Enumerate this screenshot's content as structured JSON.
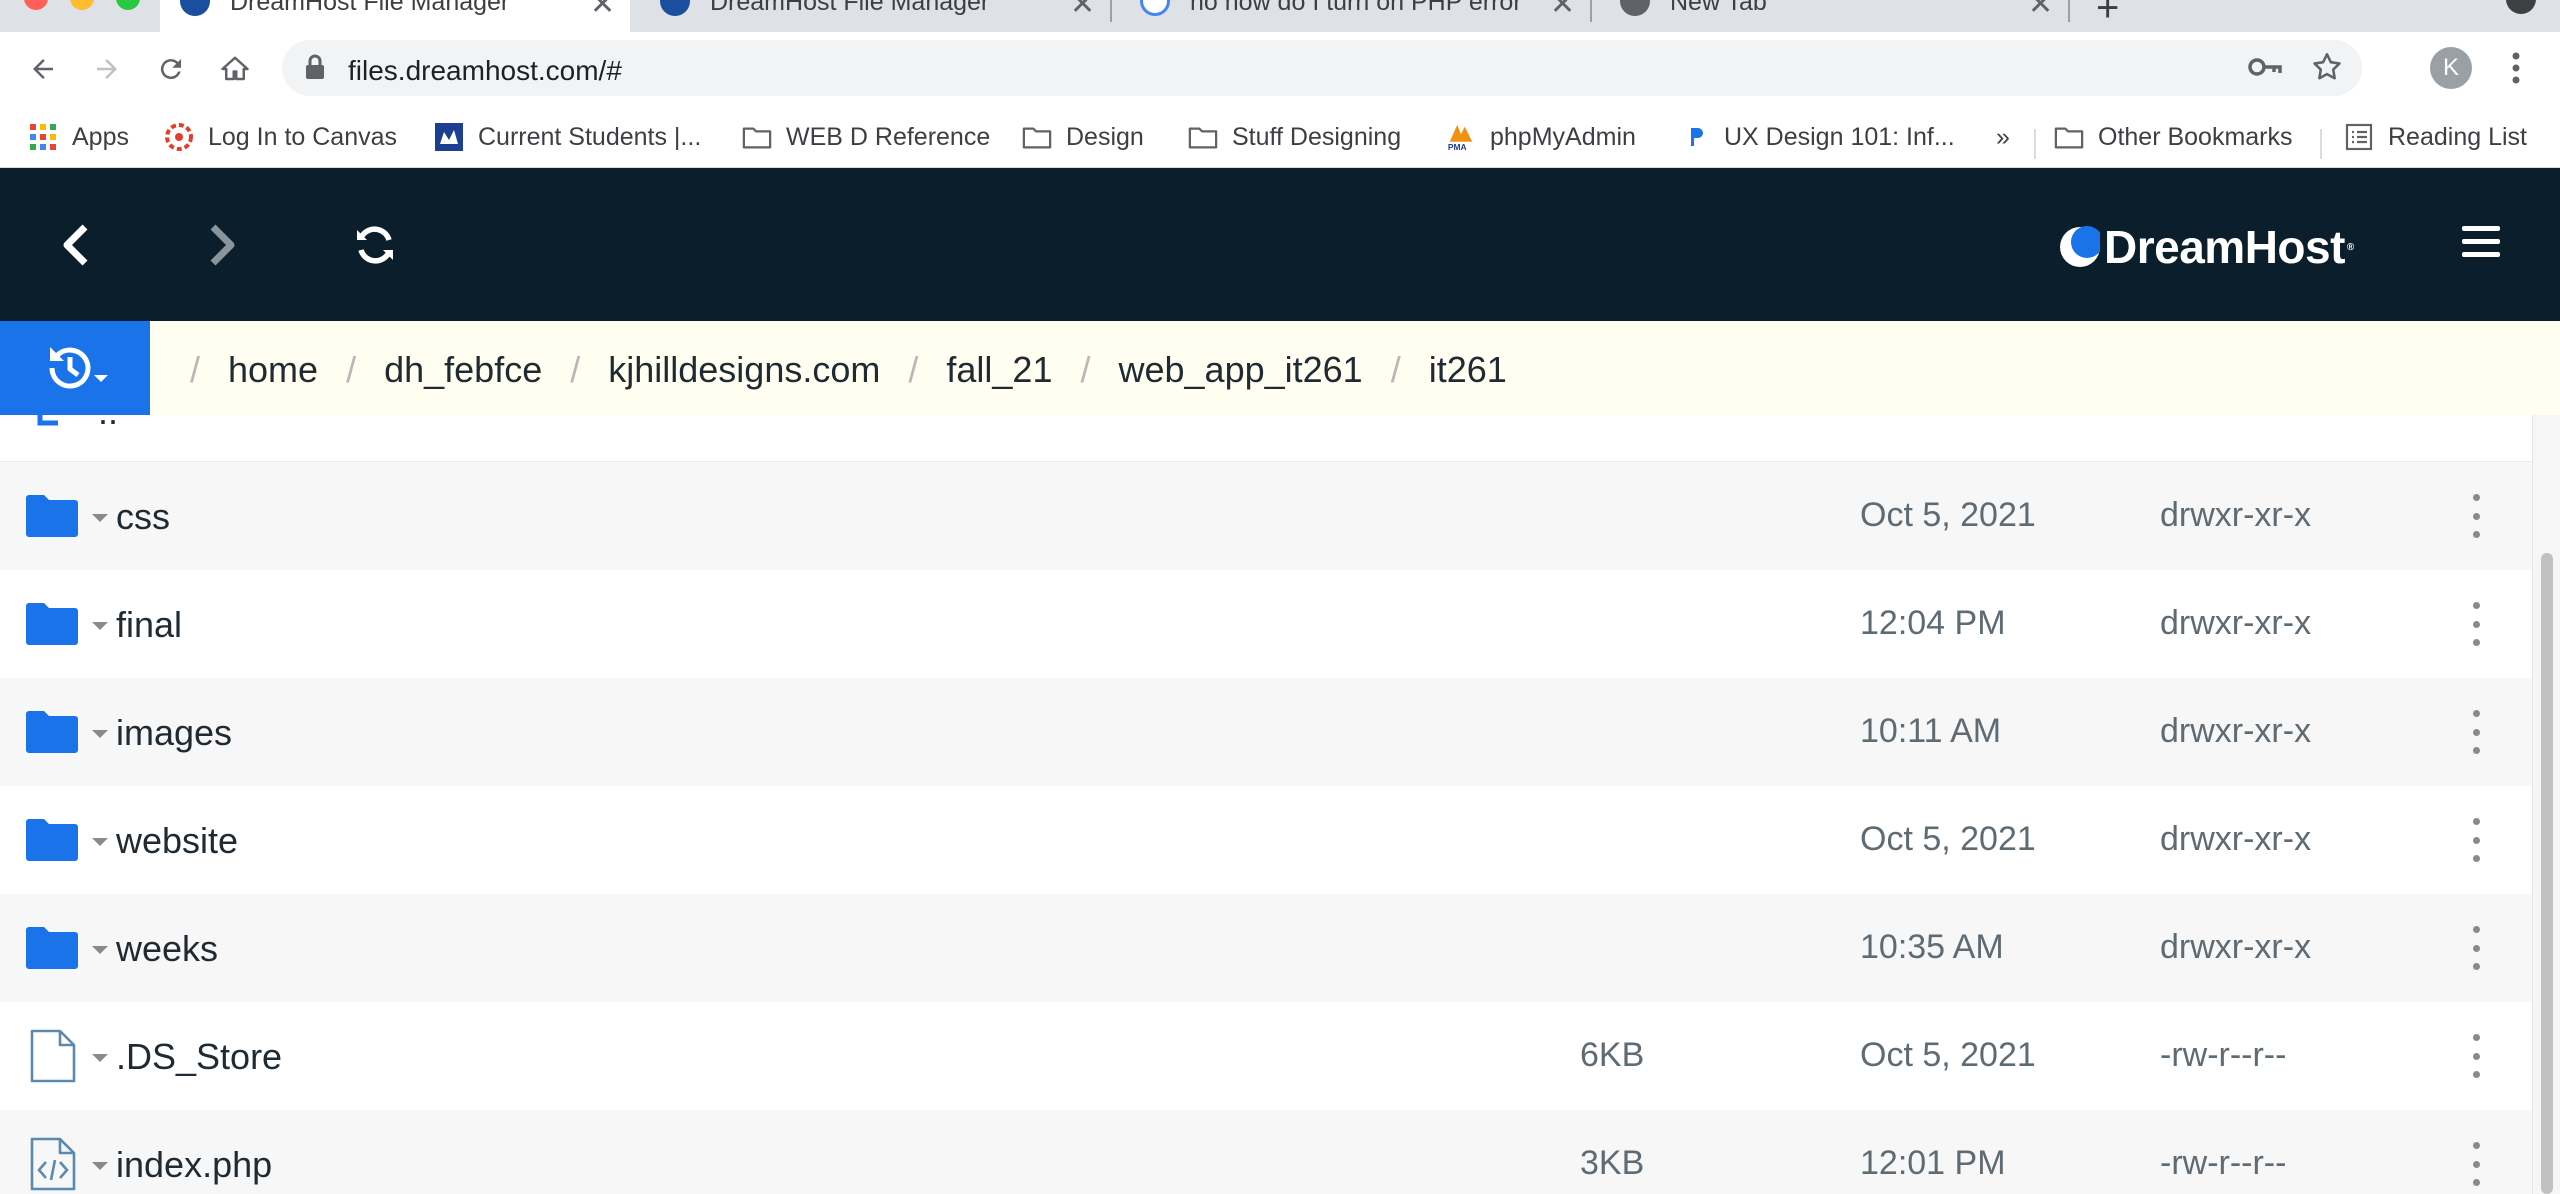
{
  "browser": {
    "tabs": [
      {
        "title": "DreamHost File Manager",
        "active": true
      },
      {
        "title": "DreamHost File Manager",
        "active": false
      },
      {
        "title": "no how do I turn on PHP error r",
        "active": false
      },
      {
        "title": "New Tab",
        "active": false
      }
    ],
    "url": "files.dreamhost.com/#",
    "profile_initial": "K"
  },
  "bookmarks": [
    {
      "label": "Apps",
      "icon": "apps-grid-icon"
    },
    {
      "label": "Log In to Canvas",
      "icon": "canvas-icon"
    },
    {
      "label": "Current Students |...",
      "icon": "students-icon"
    },
    {
      "label": "WEB D Reference",
      "icon": "folder-icon"
    },
    {
      "label": "Design",
      "icon": "folder-icon"
    },
    {
      "label": "Stuff Designing",
      "icon": "folder-icon"
    },
    {
      "label": "phpMyAdmin",
      "icon": "phpmyadmin-icon"
    },
    {
      "label": "UX Design 101: Inf...",
      "icon": "ux-icon"
    },
    {
      "label": "»",
      "icon": "chevron-more-icon"
    },
    {
      "label": "Other Bookmarks",
      "icon": "folder-icon"
    },
    {
      "label": "Reading List",
      "icon": "reading-list-icon"
    }
  ],
  "app": {
    "brand": "DreamHost",
    "brand_color": "#0b1e2b",
    "accent_color": "#1a73e8",
    "breadcrumb": [
      "home",
      "dh_febfce",
      "kjhilldesigns.com",
      "fall_21",
      "web_app_it261",
      "it261"
    ],
    "parent_label": ".."
  },
  "files": [
    {
      "name": "css",
      "type": "folder",
      "size": "",
      "modified": "Oct 5, 2021",
      "permissions": "drwxr-xr-x"
    },
    {
      "name": "final",
      "type": "folder",
      "size": "",
      "modified": "12:04 PM",
      "permissions": "drwxr-xr-x"
    },
    {
      "name": "images",
      "type": "folder",
      "size": "",
      "modified": "10:11 AM",
      "permissions": "drwxr-xr-x"
    },
    {
      "name": "website",
      "type": "folder",
      "size": "",
      "modified": "Oct 5, 2021",
      "permissions": "drwxr-xr-x"
    },
    {
      "name": "weeks",
      "type": "folder",
      "size": "",
      "modified": "10:35 AM",
      "permissions": "drwxr-xr-x"
    },
    {
      "name": ".DS_Store",
      "type": "file",
      "size": "6KB",
      "modified": "Oct 5, 2021",
      "permissions": "-rw-r--r--"
    },
    {
      "name": "index.php",
      "type": "code",
      "size": "3KB",
      "modified": "12:01 PM",
      "permissions": "-rw-r--r--"
    }
  ]
}
